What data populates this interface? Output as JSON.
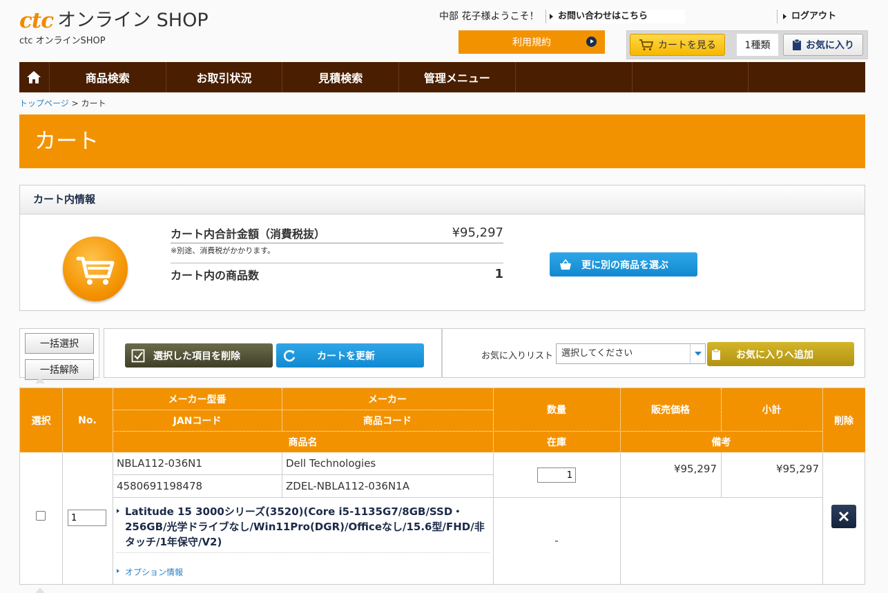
{
  "header": {
    "logo_brand": "ctc",
    "logo_text": "オンライン SHOP",
    "sub_logo": "ctc オンラインSHOP",
    "welcome": "中部 花子様ようこそ！",
    "contact_link": "お問い合わせはこちら",
    "logout_link": "ログアウト",
    "terms_button": "利用規約",
    "view_cart_button": "カートを見る",
    "cart_count": "1種類",
    "favorites_button": "お気に入り"
  },
  "nav": {
    "items": [
      "商品検索",
      "お取引状況",
      "見積検索",
      "管理メニュー",
      "",
      "",
      ""
    ]
  },
  "breadcrumb": {
    "home": "トップページ",
    "separator": ">",
    "current": "カート"
  },
  "page_title": "カート",
  "cart_info": {
    "heading": "カート内情報",
    "total_label": "カート内合計金額（消費税抜）",
    "total_value": "¥95,297",
    "tax_note": "※別途、消費税がかかります。",
    "count_label": "カート内の商品数",
    "count_value": "1",
    "select_other_button": "更に別の商品を選ぶ"
  },
  "actions": {
    "select_all": "一括選択",
    "deselect_all": "一括解除",
    "delete_selected": "選択した項目を削除",
    "update_cart": "カートを更新",
    "favorites_list_label": "お気に入りリスト",
    "favorites_select_placeholder": "選択してください",
    "add_to_favorites": "お気に入りへ追加"
  },
  "table": {
    "headers": {
      "select": "選択",
      "no": "No.",
      "maker_model": "メーカー型番",
      "maker": "メーカー",
      "jan_code": "JANコード",
      "product_code": "商品コード",
      "product_name": "商品名",
      "quantity": "数量",
      "stock": "在庫",
      "price": "販売価格",
      "subtotal": "小計",
      "remarks": "備考",
      "delete": "削除"
    },
    "rows": [
      {
        "no": "1",
        "maker_model": "NBLA112-036N1",
        "maker": "Dell Technologies",
        "jan_code": "4580691198478",
        "product_code": "ZDEL-NBLA112-036N1A",
        "product_name": "Latitude 15 3000シリーズ(3520)(Core i5-1135G7/8GB/SSD・256GB/光学ドライブなし/Win11Pro(DGR)/Officeなし/15.6型/FHD/非タッチ/1年保守/V2)",
        "quantity": "1",
        "stock": "-",
        "price": "¥95,297",
        "subtotal": "¥95,297",
        "option_link": "オプション情報"
      }
    ]
  },
  "colors": {
    "accent_orange": "#f39200",
    "nav_brown": "#4a1e00",
    "blue_button": "#1189d0",
    "navy": "#1b2a49"
  }
}
